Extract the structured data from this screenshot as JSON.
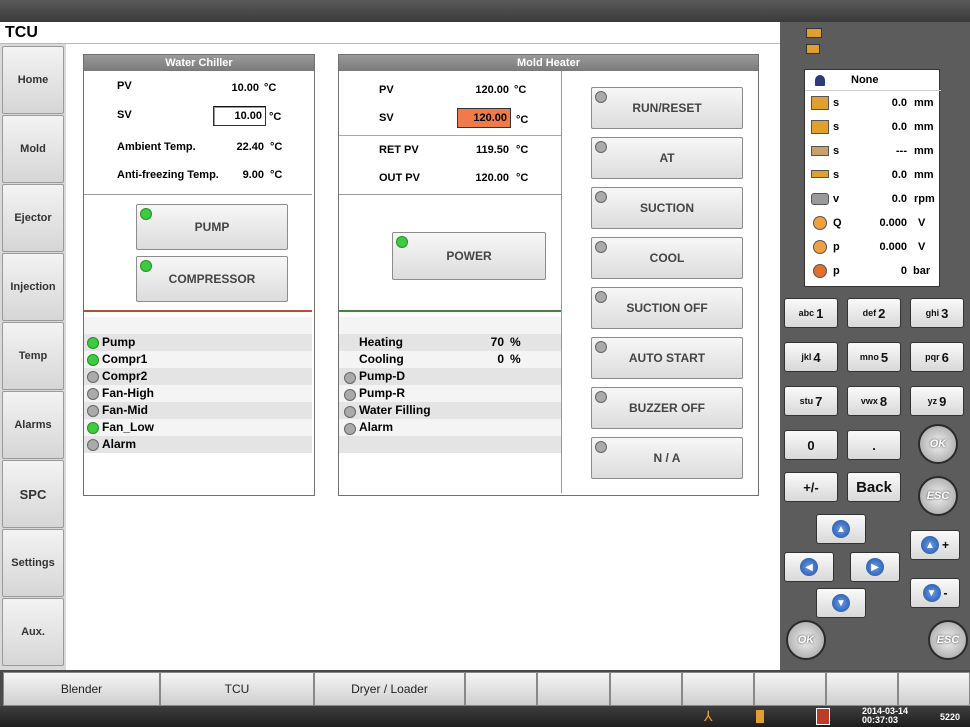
{
  "title": "TCU",
  "nav": [
    "Home",
    "Mold",
    "Ejector",
    "Injection",
    "Temp",
    "Alarms",
    "SPC",
    "Settings",
    "Aux."
  ],
  "water_chiller": {
    "header": "Water Chiller",
    "pv_label": "PV",
    "pv_value": "10.00",
    "pv_unit": "°C",
    "sv_label": "SV",
    "sv_value": "10.00",
    "sv_unit": "°C",
    "ambient_label": "Ambient Temp.",
    "ambient_value": "22.40",
    "ambient_unit": "°C",
    "antifreeze_label": "Anti-freezing Temp.",
    "antifreeze_value": "9.00",
    "antifreeze_unit": "°C",
    "pump_button": "PUMP",
    "compressor_button": "COMPRESSOR",
    "status": [
      {
        "label": "Pump",
        "on": true
      },
      {
        "label": "Compr1",
        "on": true
      },
      {
        "label": "Compr2",
        "on": false
      },
      {
        "label": "Fan-High",
        "on": false
      },
      {
        "label": "Fan-Mid",
        "on": false
      },
      {
        "label": "Fan_Low",
        "on": true
      },
      {
        "label": "Alarm",
        "on": false
      }
    ]
  },
  "mold_heater": {
    "header": "Mold Heater",
    "pv_label": "PV",
    "pv_value": "120.00",
    "pv_unit": "°C",
    "sv_label": "SV",
    "sv_value": "120.00",
    "sv_unit": "°C",
    "retpv_label": "RET PV",
    "retpv_value": "119.50",
    "retpv_unit": "°C",
    "outpv_label": "OUT PV",
    "outpv_value": "120.00",
    "outpv_unit": "°C",
    "power_button": "POWER",
    "heating_label": "Heating",
    "heating_value": "70",
    "heating_unit": "%",
    "cooling_label": "Cooling",
    "cooling_value": "0",
    "cooling_unit": "%",
    "status": [
      {
        "label": "Pump-D"
      },
      {
        "label": "Pump-R"
      },
      {
        "label": "Water Filling"
      },
      {
        "label": "Alarm"
      }
    ],
    "buttons": [
      "RUN/RESET",
      "AT",
      "SUCTION",
      "COOL",
      "SUCTION OFF",
      "AUTO START",
      "BUZZER OFF",
      "N / A"
    ]
  },
  "readouts": {
    "user": "None",
    "rows": [
      {
        "tag": "s",
        "value": "0.0",
        "unit": "mm"
      },
      {
        "tag": "s",
        "value": "0.0",
        "unit": "mm"
      },
      {
        "tag": "s",
        "value": "---",
        "unit": "mm"
      },
      {
        "tag": "s",
        "value": "0.0",
        "unit": "mm"
      },
      {
        "tag": "v",
        "value": "0.0",
        "unit": "rpm"
      },
      {
        "tag": "Q",
        "value": "0.000",
        "unit": "V"
      },
      {
        "tag": "p",
        "value": "0.000",
        "unit": "V"
      },
      {
        "tag": "p",
        "value": "0",
        "unit": "bar"
      }
    ]
  },
  "keypad": {
    "keys": [
      {
        "sub": "abc",
        "main": "1"
      },
      {
        "sub": "def",
        "main": "2"
      },
      {
        "sub": "ghi",
        "main": "3"
      },
      {
        "sub": "jkl",
        "main": "4"
      },
      {
        "sub": "mno",
        "main": "5"
      },
      {
        "sub": "pqr",
        "main": "6"
      },
      {
        "sub": "stu",
        "main": "7"
      },
      {
        "sub": "vwx",
        "main": "8"
      },
      {
        "sub": "yz",
        "main": "9"
      }
    ],
    "zero": "0",
    "dot": ".",
    "plusminus": "+/-",
    "back": "Back",
    "ok": "OK",
    "esc": "ESC",
    "plus": "+",
    "minus": "-"
  },
  "tabs": [
    "Blender",
    "TCU",
    "Dryer / Loader"
  ],
  "status_bar": {
    "date": "2014-03-14",
    "time": "00:37:03",
    "code": "5220"
  }
}
